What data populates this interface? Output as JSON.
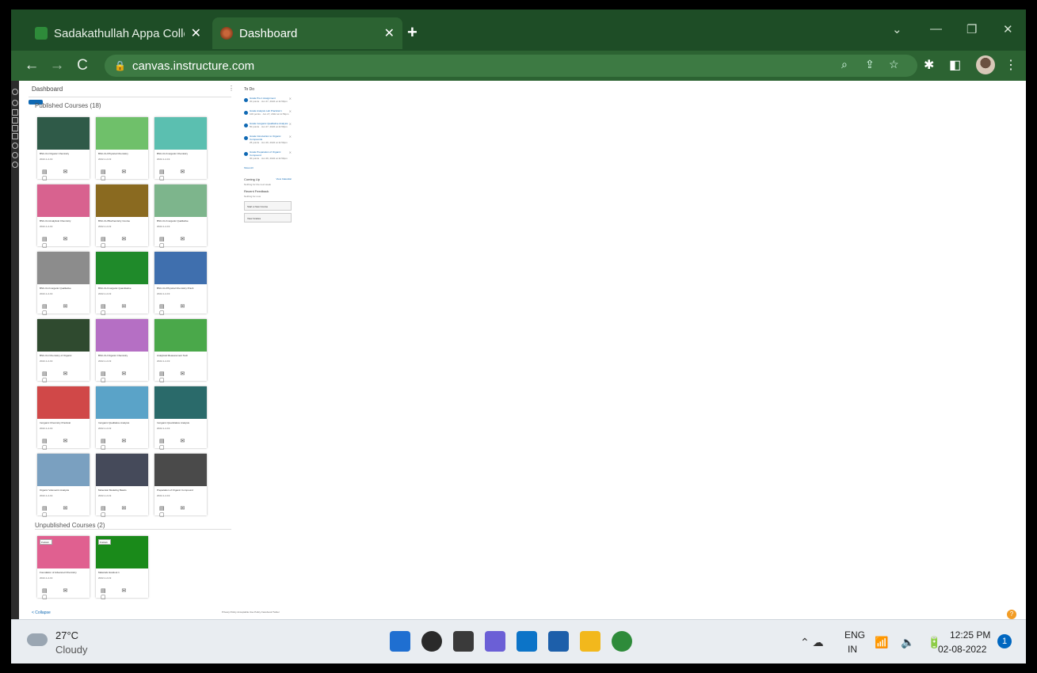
{
  "browser": {
    "tabs": [
      {
        "title": "Sadakathullah Appa College, Pala",
        "close": "✕"
      },
      {
        "title": "Dashboard",
        "close": "✕"
      }
    ],
    "new_tab": "+",
    "url": "canvas.instructure.com",
    "nav": {
      "back": "←",
      "forward": "→",
      "reload": "C"
    },
    "window_controls": [
      "⌄",
      "—",
      "❐",
      "✕"
    ]
  },
  "dashboard": {
    "header": "Dashboard",
    "options": "⋮",
    "published_heading": "Published Courses (18)",
    "unpublished_heading": "Unpublished Courses (2)",
    "cards": [
      {
        "color": "#2f5a48",
        "name": "BSC-CH Organic Chemistry",
        "term": "2022-1-2-19"
      },
      {
        "color": "#6fc06a",
        "name": "BSC-CH Physical Chemistry",
        "term": "2022-1-2-19"
      },
      {
        "color": "#5bbfb0",
        "name": "BSC-CH Inorganic Chemistry",
        "term": "2022-1-2-19"
      },
      {
        "color": "#d8628f",
        "name": "BSC-CH Analytical Chemistry",
        "term": "2022-1-2-19"
      },
      {
        "color": "#8a6a20",
        "name": "BSC-CH Biochemistry Course",
        "term": "2022-1-2-19"
      },
      {
        "color": "#7db58c",
        "name": "BSC-CH Inorganic Qualitative",
        "term": "2022-1-2-19"
      },
      {
        "color": "#8c8c8c",
        "name": "BSC-CH Inorganic Qualitative",
        "term": "2022-1-2-19"
      },
      {
        "color": "#1f8a2a",
        "name": "BSC-CH Inorganic Quantitative",
        "term": "2022-1-2-19"
      },
      {
        "color": "#3f6fae",
        "name": "BSC-CH Physical Chemistry Practi",
        "term": "2022-1-2-19"
      },
      {
        "color": "#2f4a2f",
        "name": "BSC-CH Chemistry of Organic",
        "term": "2022-1-2-19"
      },
      {
        "color": "#b56fc4",
        "name": "BSC-CH Organic Chemistry",
        "term": "2022-1-2-19"
      },
      {
        "color": "#4aa84a",
        "name": "Analytical Measurement Tech",
        "term": "2022-1-2-19"
      },
      {
        "color": "#d04848",
        "name": "Inorganic Chemistry Practical",
        "term": "2022-1-2-19"
      },
      {
        "color": "#5aa3c8",
        "name": "Inorganic Qualitative Analysis",
        "term": "2022-1-2-19"
      },
      {
        "color": "#2a6a6a",
        "name": "Inorganic Quantitative Analysis",
        "term": "2022-1-2-19"
      },
      {
        "color": "#7aa0c0",
        "name": "Organic Volumetric Analysis",
        "term": "2022-1-2-19"
      },
      {
        "color": "#454a5a",
        "name": "Molecular Modeling Basics",
        "term": "2022-1-2-19"
      },
      {
        "color": "#4a4a4a",
        "name": "Preparation of Organic Compound",
        "term": "2022-1-2-19"
      }
    ],
    "unpublished_cards": [
      {
        "color": "#e06090",
        "name": "Foundation of Advanced Chemistry",
        "term": "2022-1-2-19",
        "tag": "Publish"
      },
      {
        "color": "#1a8a1a",
        "name": "Materials Handout 1",
        "term": "2022-1-2-19",
        "tag": "Publish"
      }
    ],
    "card_icons": "▤ ✉ ▢",
    "footer_left": "< Collapse",
    "footer_links": "Privacy Policy  Acceptable Use Policy  Facebook  Twitter"
  },
  "sidebar": {
    "todo_heading": "To Do",
    "todo_items": [
      {
        "title": "Grade Pra 1 Assignment",
        "sub": "20 points · Jun 27, 2022 at 11:59pm"
      },
      {
        "title": "Grade Analysis Lab Practical 1",
        "sub": "100 points · Jun 27, 2022 at 11:59pm"
      },
      {
        "title": "Grade Inorganic Qualitative Analysis",
        "sub": "50 points · Jun 27, 2022 at 11:59pm"
      },
      {
        "title": "Grade Introduction to Organic Compounds",
        "sub": "25 points · Jun 26, 2022 at 11:59pm"
      },
      {
        "title": "Grade Preparation of Organic Compound",
        "sub": "30 points · Jun 26, 2022 at 11:59pm"
      }
    ],
    "show_all": "Show All",
    "coming_up": "Coming Up",
    "view_calendar": "View Calendar",
    "coming_up_sub": "Nothing for the next week",
    "recent_feedback": "Recent Feedback",
    "feedback_sub": "Nothing for now",
    "start_new_course": "Start a New Course",
    "view_grades": "View Grades",
    "close": "✕"
  },
  "help": "?",
  "taskbar": {
    "temp": "27°C",
    "condition": "Cloudy",
    "apps": [
      {
        "name": "start",
        "color": "#1f6fd1"
      },
      {
        "name": "search",
        "color": "#2a2a2a"
      },
      {
        "name": "task-view",
        "color": "#3a3a3a"
      },
      {
        "name": "chat",
        "color": "#6b5fd6"
      },
      {
        "name": "mail",
        "color": "#0c74c8"
      },
      {
        "name": "store",
        "color": "#1d5faa"
      },
      {
        "name": "explorer",
        "color": "#f2b81c"
      },
      {
        "name": "chrome",
        "color": "#2e8b3a"
      }
    ],
    "lang1": "ENG",
    "lang2": "IN",
    "tray": "⌃ ☁",
    "tray_right": "📶 🔈 🔋",
    "time": "12:25 PM",
    "date": "02-08-2022",
    "notifications": "1"
  }
}
